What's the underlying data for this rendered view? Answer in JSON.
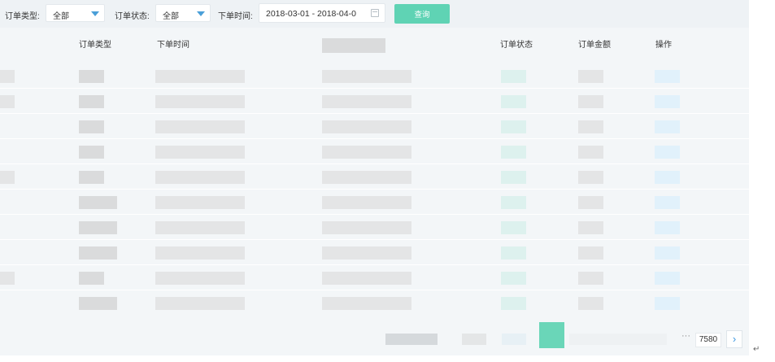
{
  "filters": {
    "order_type_label": "订单类型:",
    "order_type_value": "全部",
    "order_status_label": "订单状态:",
    "order_status_value": "全部",
    "order_time_label": "下单时间:",
    "date_range": "2018-03-01 - 2018-04-0",
    "query_label": "查询"
  },
  "table": {
    "headers": {
      "order_type": "订单类型",
      "order_time": "下单时间",
      "order_status": "订单状态",
      "order_amount": "订单金额",
      "actions": "操作"
    },
    "row_count": 10
  },
  "pagination": {
    "ellipsis": "···",
    "last_page": "7580",
    "next_icon": "chevron-right-icon"
  },
  "colors": {
    "accent": "#5fd3b4",
    "link": "#3b97e0",
    "caret": "#4a9fd8"
  }
}
